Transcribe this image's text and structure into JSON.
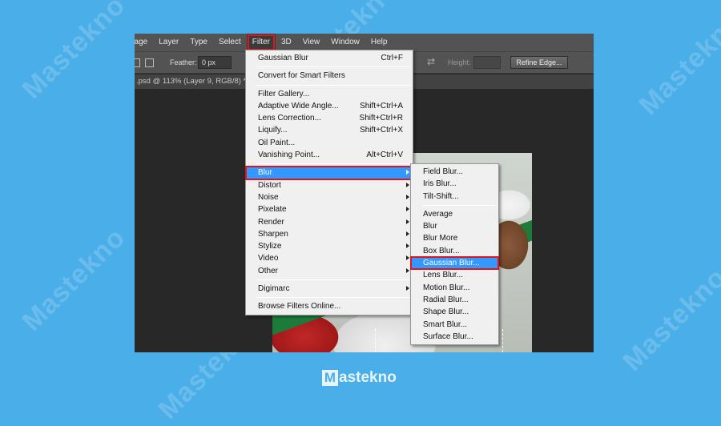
{
  "watermark": "Mastekno",
  "menubar": {
    "items": [
      "nage",
      "Layer",
      "Type",
      "Select",
      "Filter",
      "3D",
      "View",
      "Window",
      "Help"
    ],
    "active": "Filter"
  },
  "options_bar": {
    "feather_label": "Feather:",
    "feather_value": "0 px",
    "height_label": "Height:",
    "refine_edge_label": "Refine Edge..."
  },
  "document_tab": {
    "title": ".psd @ 113% (Layer 9, RGB/8) *"
  },
  "filter_menu": {
    "items": [
      {
        "label": "Gaussian Blur",
        "shortcut": "Ctrl+F"
      },
      {
        "sep": true
      },
      {
        "label": "Convert for Smart Filters"
      },
      {
        "sep": true
      },
      {
        "label": "Filter Gallery..."
      },
      {
        "label": "Adaptive Wide Angle...",
        "shortcut": "Shift+Ctrl+A"
      },
      {
        "label": "Lens Correction...",
        "shortcut": "Shift+Ctrl+R"
      },
      {
        "label": "Liquify...",
        "shortcut": "Shift+Ctrl+X"
      },
      {
        "label": "Oil Paint..."
      },
      {
        "label": "Vanishing Point...",
        "shortcut": "Alt+Ctrl+V"
      },
      {
        "sep": true
      },
      {
        "label": "Blur",
        "submenu": true,
        "highlighted": true
      },
      {
        "label": "Distort",
        "submenu": true
      },
      {
        "label": "Noise",
        "submenu": true
      },
      {
        "label": "Pixelate",
        "submenu": true
      },
      {
        "label": "Render",
        "submenu": true
      },
      {
        "label": "Sharpen",
        "submenu": true
      },
      {
        "label": "Stylize",
        "submenu": true
      },
      {
        "label": "Video",
        "submenu": true
      },
      {
        "label": "Other",
        "submenu": true
      },
      {
        "sep": true
      },
      {
        "label": "Digimarc",
        "submenu": true
      },
      {
        "sep": true
      },
      {
        "label": "Browse Filters Online..."
      }
    ]
  },
  "blur_submenu": {
    "items": [
      {
        "label": "Field Blur..."
      },
      {
        "label": "Iris Blur..."
      },
      {
        "label": "Tilt-Shift..."
      },
      {
        "sep": true
      },
      {
        "label": "Average"
      },
      {
        "label": "Blur"
      },
      {
        "label": "Blur More"
      },
      {
        "label": "Box Blur..."
      },
      {
        "label": "Gaussian Blur...",
        "highlighted": true
      },
      {
        "label": "Lens Blur..."
      },
      {
        "label": "Motion Blur..."
      },
      {
        "label": "Radial Blur..."
      },
      {
        "label": "Shape Blur..."
      },
      {
        "label": "Smart Blur..."
      },
      {
        "label": "Surface Blur..."
      }
    ]
  },
  "footer": {
    "logo_letter": "M",
    "logo_rest": "astekno"
  },
  "colors": {
    "background": "#4aaee8",
    "highlight": "#3399ff",
    "callout_border": "#e0151b"
  }
}
